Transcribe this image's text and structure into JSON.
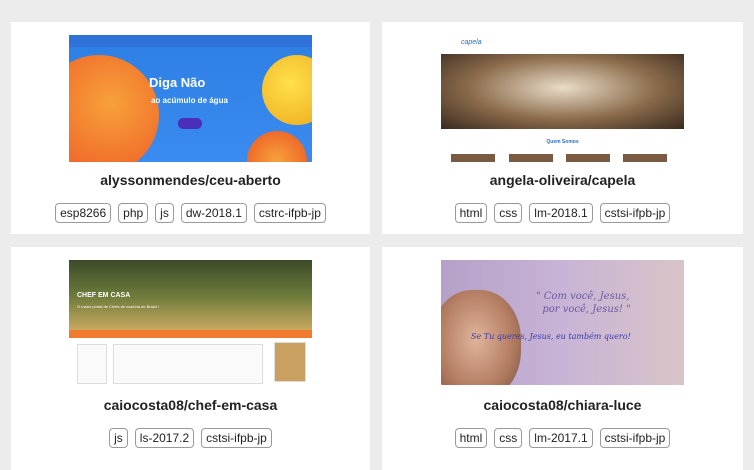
{
  "projects": [
    {
      "title": "alyssonmendes/ceu-aberto",
      "tags": [
        "esp8266",
        "php",
        "js",
        "dw-2018.1",
        "cstrc-ifpb-jp"
      ],
      "thumb": {
        "headline": "Diga Não",
        "subline": "ao acúmulo de água"
      }
    },
    {
      "title": "angela-oliveira/capela",
      "tags": [
        "html",
        "css",
        "lm-2018.1",
        "cstsi-ifpb-jp"
      ],
      "thumb": {
        "logo": "capela",
        "section": "Quem Somos"
      }
    },
    {
      "title": "caiocosta08/chef-em-casa",
      "tags": [
        "js",
        "ls-2017.2",
        "cstsi-ifpb-jp"
      ],
      "thumb": {
        "headline": "CHEF EM CASA",
        "subline": "O maior portal de Chefs de cozinha do Brasil !"
      }
    },
    {
      "title": "caiocosta08/chiara-luce",
      "tags": [
        "html",
        "css",
        "lm-2017.1",
        "cstsi-ifpb-jp"
      ],
      "thumb": {
        "quote1": "\" Com você, Jesus,\n  por você, Jesus! \"",
        "quote2": "Se Tu queres, Jesus, eu também quero!"
      }
    }
  ]
}
